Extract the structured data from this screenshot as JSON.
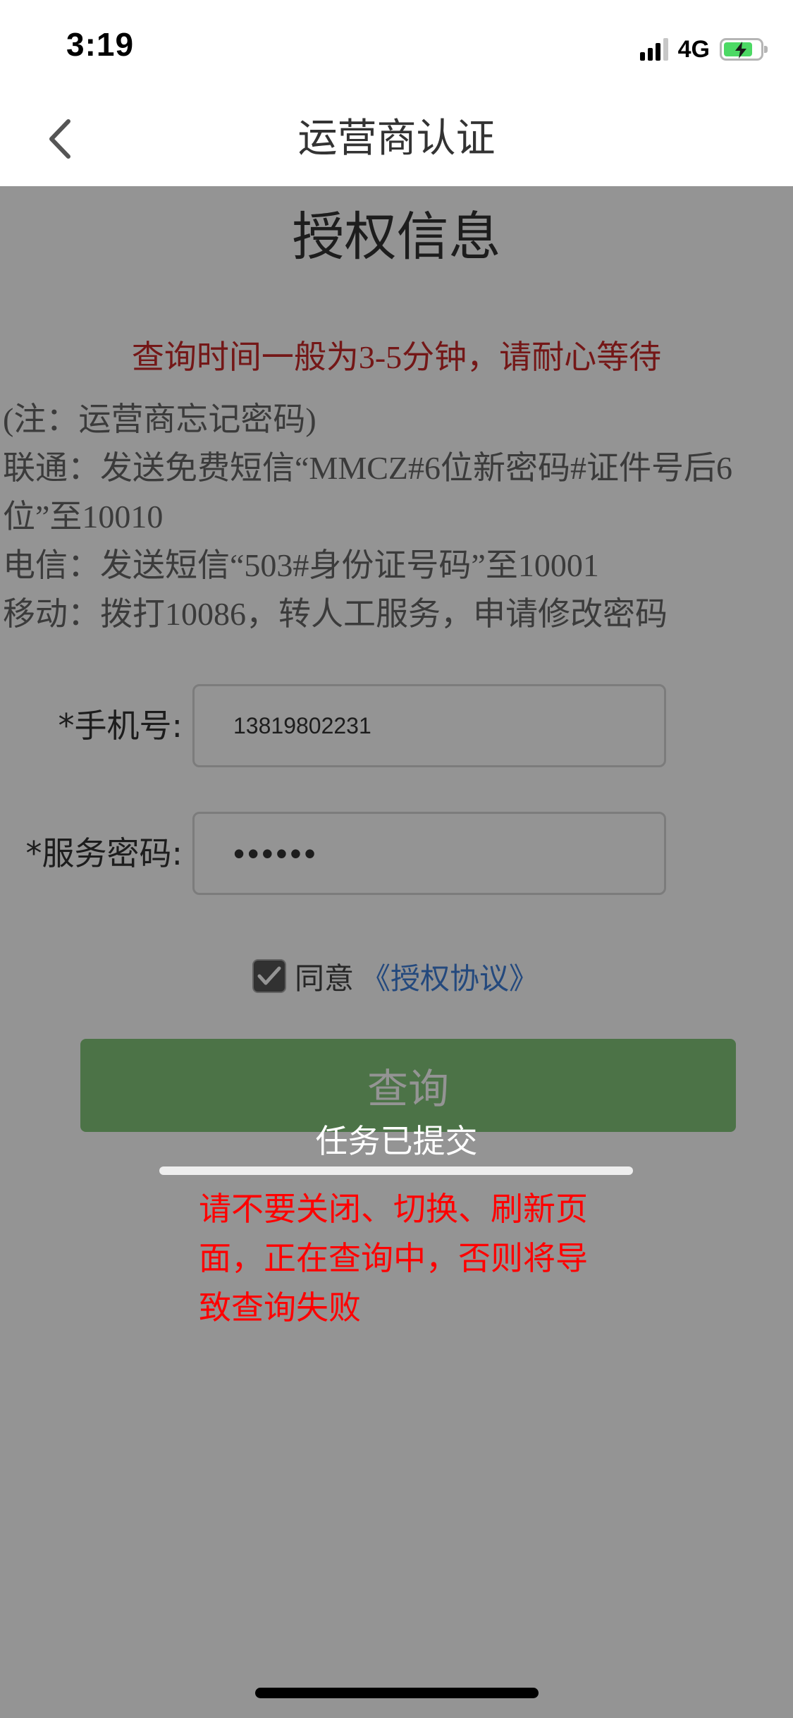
{
  "status_bar": {
    "time": "3:19",
    "network": "4G",
    "battery_level": 0.8,
    "battery_color": "#4cd964"
  },
  "nav": {
    "title": "运营商认证",
    "back_icon": "chevron-left-icon"
  },
  "page": {
    "heading": "授权信息",
    "wait_tip": "查询时间一般为3-5分钟，请耐心等待",
    "notes": [
      "(注：运营商忘记密码)",
      "联通：发送免费短信“MMCZ#6位新密码#证件号后6位”至10010",
      "电信：发送短信“503#身份证号码”至10001",
      "移动：拨打10086，转人工服务，申请修改密码"
    ]
  },
  "form": {
    "phone_label": "*手机号:",
    "phone_value": "13819802231",
    "password_label": "*服务密码:",
    "password_value": "••••••"
  },
  "agreement": {
    "checked": true,
    "text": "同意",
    "link": "《授权协议》"
  },
  "query_button": {
    "label": "查询",
    "color": "#83c77a"
  },
  "toast": {
    "title": "任务已提交",
    "progress": 1.0,
    "warning": "请不要关闭、切换、刷新页面，正在查询中，否则将导致查询失败",
    "warning_color": "#ff0000"
  }
}
